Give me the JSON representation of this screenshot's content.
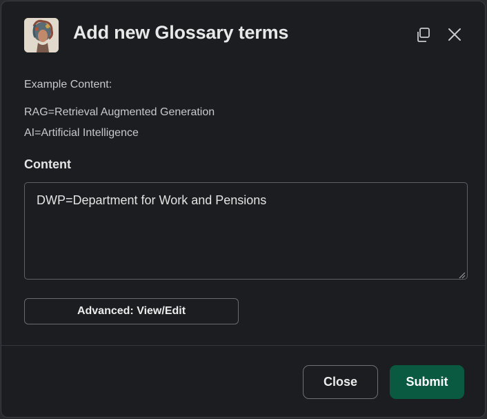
{
  "modal": {
    "title": "Add new Glossary terms",
    "avatar_icon": "bot-avatar-icon",
    "header_icons": [
      "copy-icon",
      "close-icon"
    ]
  },
  "body": {
    "example_label": "Example Content:",
    "example_lines": [
      "RAG=Retrieval Augmented Generation",
      "AI=Artificial Intelligence"
    ],
    "content_label": "Content",
    "content_value": "DWP=Department for Work and Pensions",
    "advanced_label": "Advanced: View/Edit"
  },
  "footer": {
    "close_label": "Close",
    "submit_label": "Submit"
  },
  "colors": {
    "modal_bg": "#1b1d21",
    "submit_bg": "#0a5a41",
    "text": "#e8e8e8"
  }
}
